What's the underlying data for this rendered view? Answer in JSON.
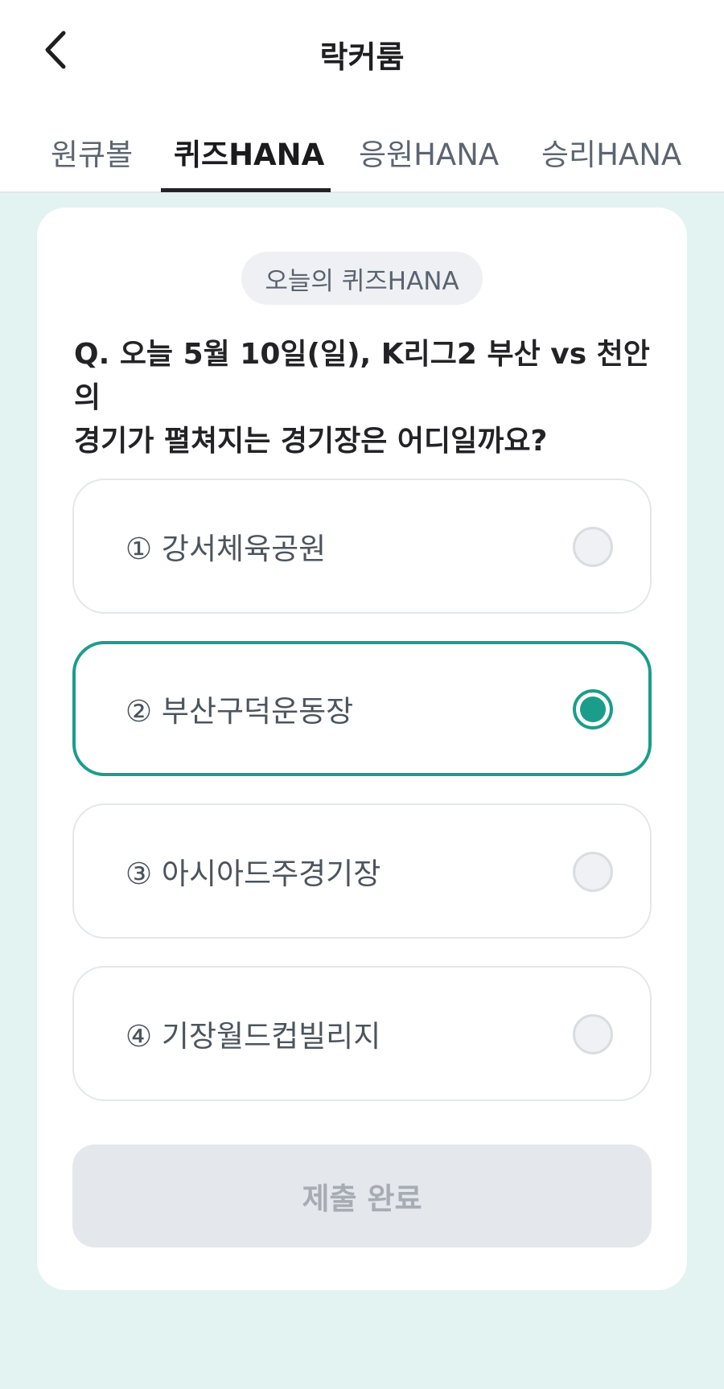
{
  "header": {
    "title": "락커룸",
    "back_icon": "chevron-left-icon"
  },
  "tabs": [
    {
      "label": "원큐볼",
      "active": false
    },
    {
      "label": "퀴즈HANA",
      "active": true
    },
    {
      "label": "응원HANA",
      "active": false
    },
    {
      "label": "승리HANA",
      "active": false
    }
  ],
  "quiz": {
    "badge": "오늘의 퀴즈HANA",
    "question_line1": "Q. 오늘 5월 10일(일), K리그2 부산 vs 천안의",
    "question_line2": "경기가 펼쳐지는 경기장은 어디일까요?",
    "options": [
      {
        "label": "① 강서체육공원",
        "selected": false
      },
      {
        "label": "② 부산구덕운동장",
        "selected": true
      },
      {
        "label": "③ 아시아드주경기장",
        "selected": false
      },
      {
        "label": "④ 기장월드컵빌리지",
        "selected": false
      }
    ],
    "submit_label": "제출 완료"
  },
  "colors": {
    "accent": "#1b9d8b",
    "background": "#e3f3f1",
    "card": "#ffffff",
    "disabled_button": "#e4e7eb"
  }
}
